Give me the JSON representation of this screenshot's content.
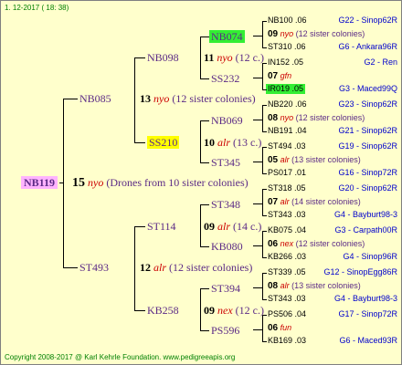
{
  "date": "1. 12-2017 ( 18: 38)",
  "copyright": "Copyright 2008-2017 @ Karl Kehrle Foundation.   www.pedigreeapis.org",
  "gen0": {
    "id": "NB119",
    "num": "15",
    "yr": "nyo",
    "note": "(Drones from 10 sister colonies)"
  },
  "gen1": [
    {
      "id": "NB085",
      "num": "13",
      "yr": "nyo",
      "note": "(12 sister colonies)"
    },
    {
      "id": "ST493",
      "num": "12",
      "yr": "alr",
      "note": "(12 sister colonies)"
    }
  ],
  "gen2": [
    {
      "id": "NB098",
      "num": "11",
      "yr": "nyo",
      "note": "(12 c.)"
    },
    {
      "id": "SS210",
      "num": "10",
      "yr": "alr",
      "note": "(13 c.)"
    },
    {
      "id": "ST114",
      "num": "09",
      "yr": "alr",
      "note": "(14 c.)"
    },
    {
      "id": "KB258",
      "num": "09",
      "yr": "nex",
      "note": "(12 c.)"
    }
  ],
  "gen3": [
    {
      "id": "NB074"
    },
    {
      "id": "SS232"
    },
    {
      "id": "NB069"
    },
    {
      "id": "ST345"
    },
    {
      "id": "ST348"
    },
    {
      "id": "KB080"
    },
    {
      "id": "ST394"
    },
    {
      "id": "PS596"
    }
  ],
  "gen4": [
    {
      "a": "NB100 .06",
      "ar": "G22 - Sinop62R",
      "m": "09",
      "my": "nyo",
      "mn": "(12 sister colonies)",
      "b": "ST310 .06",
      "br": "G6 - Ankara96R"
    },
    {
      "a": "IN152 .05",
      "ar": "G2 - Ren",
      "m": "07",
      "my": "gfn",
      "mn": "",
      "b": "IR019 .05",
      "br": "G3 - Maced99Q"
    },
    {
      "a": "NB220 .06",
      "ar": "G23 - Sinop62R",
      "m": "08",
      "my": "nyo",
      "mn": "(12 sister colonies)",
      "b": "NB191 .04",
      "br": "G21 - Sinop62R"
    },
    {
      "a": "ST494 .03",
      "ar": "G19 - Sinop62R",
      "m": "05",
      "my": "alr",
      "mn": "(13 sister colonies)",
      "b": "PS017 .01",
      "br": "G16 - Sinop72R"
    },
    {
      "a": "ST318 .05",
      "ar": "G20 - Sinop62R",
      "m": "07",
      "my": "alr",
      "mn": "(14 sister colonies)",
      "b": "ST343 .03",
      "br": "G4 - Bayburt98-3"
    },
    {
      "a": "KB075 .04",
      "ar": "G3 - Carpath00R",
      "m": "06",
      "my": "nex",
      "mn": "(12 sister colonies)",
      "b": "KB266 .03",
      "br": "G4 - Sinop96R"
    },
    {
      "a": "ST339 .05",
      "ar": "G12 - SinopEgg86R",
      "m": "08",
      "my": "alr",
      "mn": "(13 sister colonies)",
      "b": "ST343 .03",
      "br": "G4 - Bayburt98-3"
    },
    {
      "a": "PS506 .04",
      "ar": "G17 - Sinop72R",
      "m": "06",
      "my": "fun",
      "mn": "",
      "b": "KB169 .03",
      "br": "G6 - Maced93R"
    }
  ]
}
